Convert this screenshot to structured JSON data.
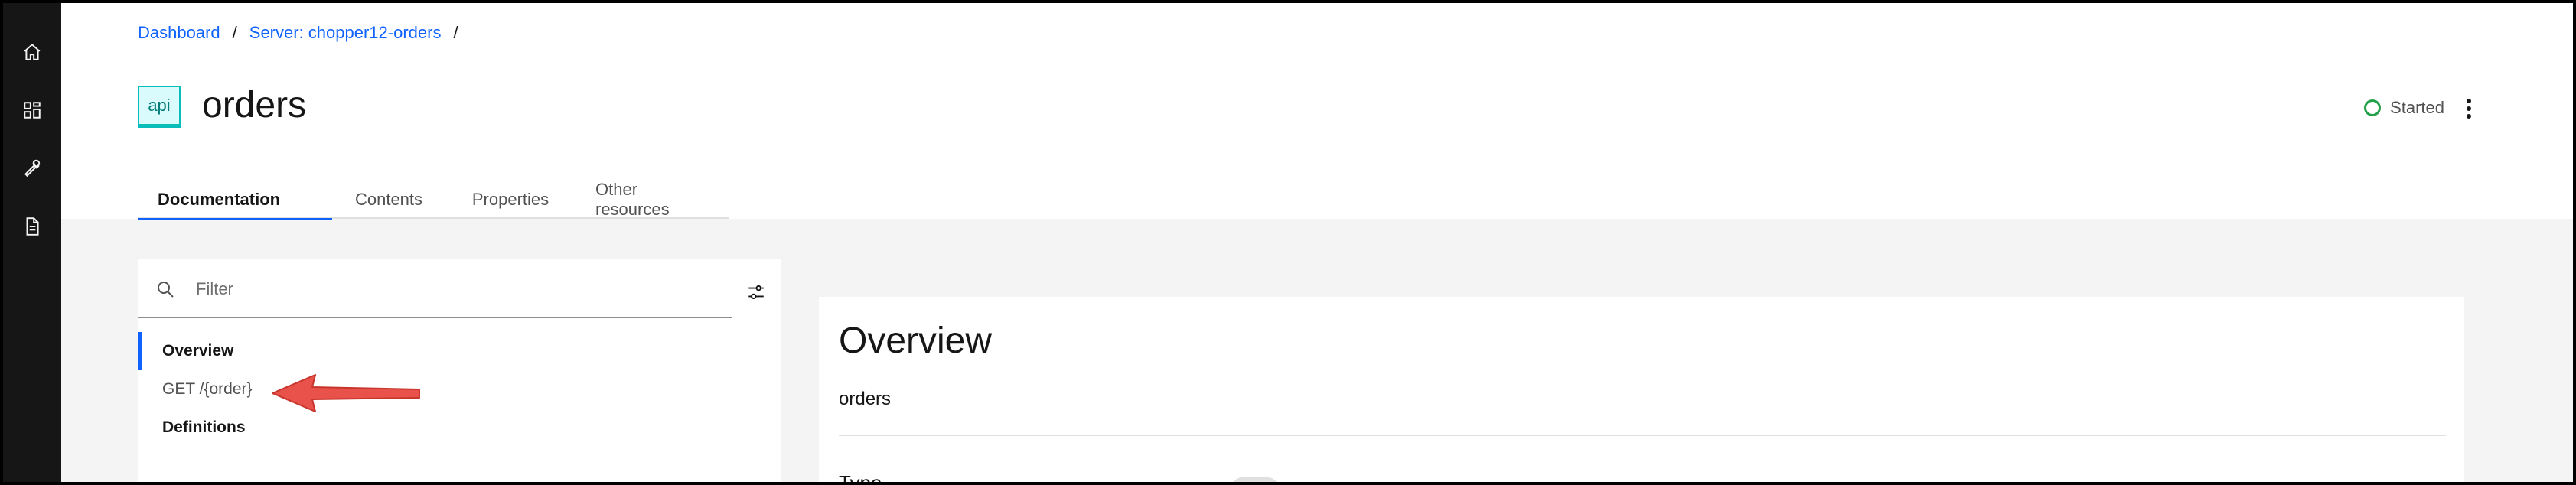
{
  "breadcrumb": {
    "items": [
      "Dashboard",
      "Server: chopper12-orders"
    ],
    "separator": "/"
  },
  "header": {
    "badge": "api",
    "title": "orders",
    "status": "Started"
  },
  "tabs": [
    {
      "label": "Documentation",
      "active": true
    },
    {
      "label": "Contents"
    },
    {
      "label": "Properties"
    },
    {
      "label": "Other resources"
    }
  ],
  "filter": {
    "placeholder": "Filter"
  },
  "nav": {
    "items": [
      {
        "label": "Overview"
      },
      {
        "label": "GET /{order}"
      },
      {
        "label": "Definitions"
      }
    ]
  },
  "content": {
    "title": "Overview",
    "subtitle": "orders",
    "type_label": "Type"
  },
  "icons": {
    "sidenav": [
      "home-icon",
      "apps-icon",
      "tools-icon",
      "document-icon"
    ],
    "search": "search-icon",
    "filter": "settings-adjust-icon",
    "overflow": "overflow-menu-icon"
  },
  "colors": {
    "accent": "#0f62fe",
    "sidenav": "#161616",
    "status": "#24a148",
    "badge": "#08bdba",
    "arrow": "#e8524a"
  }
}
